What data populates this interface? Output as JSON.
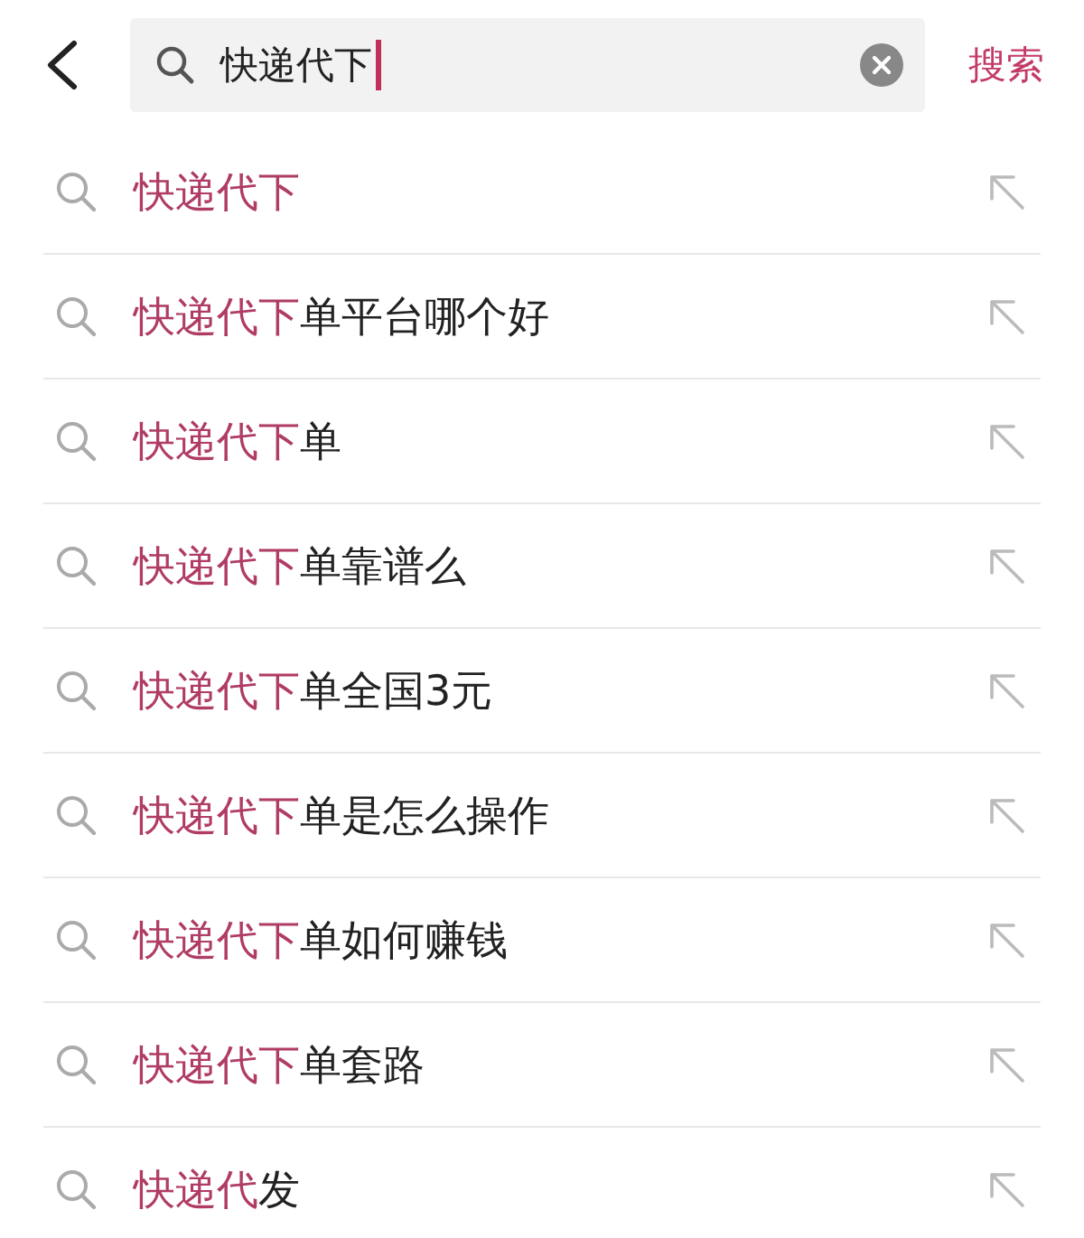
{
  "search_bar": {
    "value": "快递代下",
    "search_button": "搜索"
  },
  "suggestions": [
    {
      "match": "快递代下"
    },
    {
      "match": "快递代下",
      "rest": "单平台哪个好"
    },
    {
      "match": "快递代下",
      "rest": "单"
    },
    {
      "match": "快递代下",
      "rest": "单靠谱么"
    },
    {
      "match": "快递代下",
      "rest": "单全国3元"
    },
    {
      "match": "快递代下",
      "rest": "单是怎么操作"
    },
    {
      "match": "快递代下",
      "rest": "单如何赚钱"
    },
    {
      "match": "快递代下",
      "rest": "单套路"
    },
    {
      "match": "快递代",
      "rest": "发"
    }
  ]
}
